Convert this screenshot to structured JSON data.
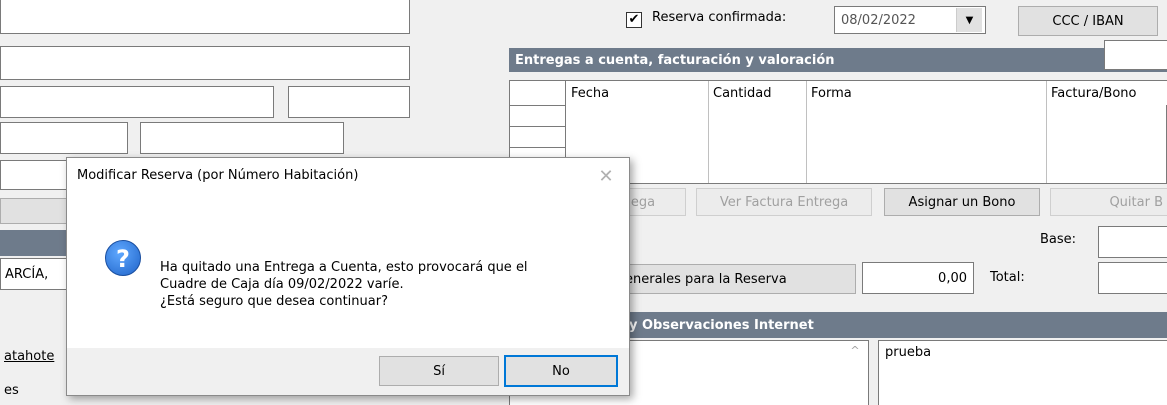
{
  "background_form": {
    "confirmed_checkbox_label": "Reserva confirmada:",
    "confirmed_date": "08/02/2022",
    "iban_button": "CCC / IBAN",
    "entregas_section_title": "Entregas a cuenta, facturación y valoración",
    "grid_columns": [
      "Fecha",
      "Cantidad",
      "Forma",
      "Factura/Bono"
    ],
    "buttons": {
      "entrega_partial": "ega",
      "ver_factura": "Ver Factura Entrega",
      "asignar_bono": "Asignar un Bono",
      "quitar_partial": "Quitar B"
    },
    "base_label": "Base:",
    "total_label": "Total:",
    "generales_button_partial": "enerales para la Reserva",
    "amount_value": "0,00",
    "observaciones_section_partial": "y Observaciones Internet",
    "observaciones_text": "prueba",
    "left_partials": {
      "name_fragment": "ARCÍA,",
      "link_fragment": "atahote",
      "text_fragment": "es"
    }
  },
  "dialog": {
    "title": "Modificar Reserva (por Número Habitación)",
    "message_line1": "Ha quitado una Entrega a Cuenta, esto provocará que el",
    "message_line2": "Cuadre de Caja día 09/02/2022 varíe.",
    "question": "¿Está seguro que desea continuar?",
    "yes_button": "Sí",
    "no_button": "No",
    "icon": "question-icon"
  }
}
